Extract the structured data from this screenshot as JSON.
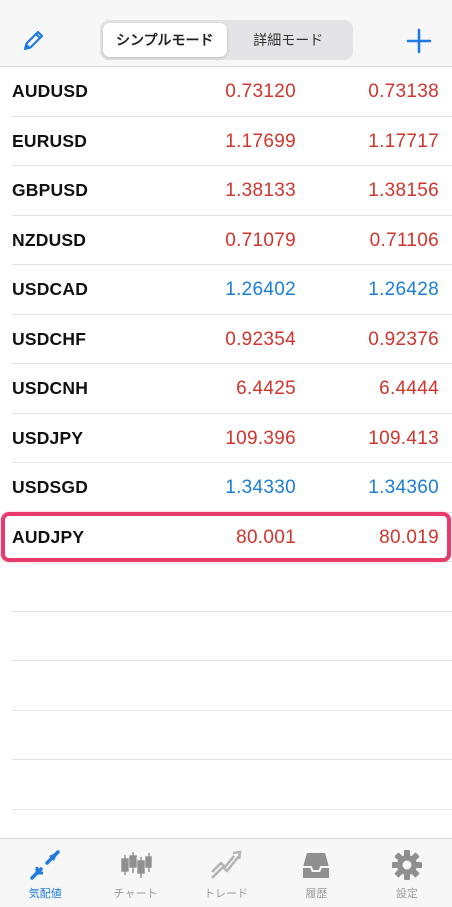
{
  "header": {
    "edit_icon": "pencil-icon",
    "add_icon": "plus-icon",
    "modes": [
      "シンプルモード",
      "詳細モード"
    ],
    "active_mode": "シンプルモード"
  },
  "quotes": [
    {
      "symbol": "AUDUSD",
      "bid": "0.73120",
      "ask": "0.73138",
      "color": "red"
    },
    {
      "symbol": "EURUSD",
      "bid": "1.17699",
      "ask": "1.17717",
      "color": "red"
    },
    {
      "symbol": "GBPUSD",
      "bid": "1.38133",
      "ask": "1.38156",
      "color": "red"
    },
    {
      "symbol": "NZDUSD",
      "bid": "0.71079",
      "ask": "0.71106",
      "color": "red"
    },
    {
      "symbol": "USDCAD",
      "bid": "1.26402",
      "ask": "1.26428",
      "color": "blue"
    },
    {
      "symbol": "USDCHF",
      "bid": "0.92354",
      "ask": "0.92376",
      "color": "red"
    },
    {
      "symbol": "USDCNH",
      "bid": "6.4425",
      "ask": "6.4444",
      "color": "red"
    },
    {
      "symbol": "USDJPY",
      "bid": "109.396",
      "ask": "109.413",
      "color": "red"
    },
    {
      "symbol": "USDSGD",
      "bid": "1.34330",
      "ask": "1.34360",
      "color": "blue"
    },
    {
      "symbol": "AUDJPY",
      "bid": "80.001",
      "ask": "80.019",
      "color": "red"
    }
  ],
  "highlighted_symbol": "AUDJPY",
  "colors": {
    "red": "#d0342c",
    "blue": "#1a7ed8",
    "accent": "#1f7be0",
    "highlight": "#e83a6b"
  },
  "tabs": [
    {
      "label": "気配値",
      "icon": "quotes-icon",
      "active": true
    },
    {
      "label": "チャート",
      "icon": "candlestick-chart-icon",
      "active": false
    },
    {
      "label": "トレード",
      "icon": "trade-icon",
      "active": false
    },
    {
      "label": "履歴",
      "icon": "history-inbox-icon",
      "active": false
    },
    {
      "label": "設定",
      "icon": "gear-icon",
      "active": false
    }
  ]
}
